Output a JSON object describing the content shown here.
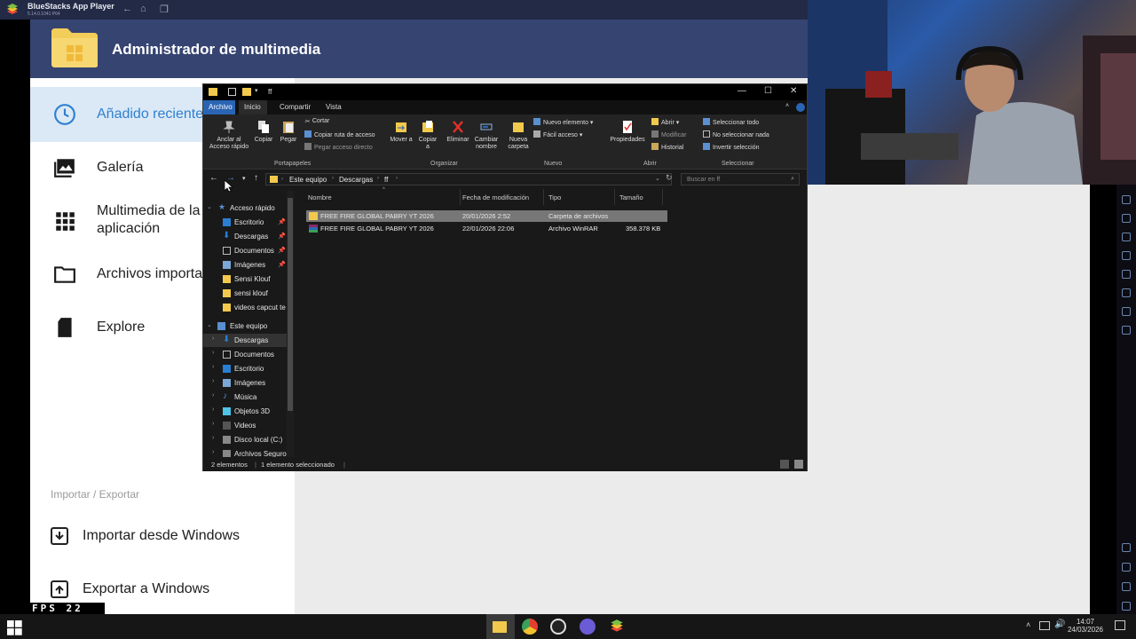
{
  "bluestacks": {
    "title": "BlueStacks App Player",
    "subtitle": "5.14.0.1041 P64"
  },
  "media_manager": {
    "title": "Administrador de multimedia",
    "nav": [
      {
        "label": "Añadido recientemente",
        "icon": "clock-icon",
        "active": true
      },
      {
        "label": "Galería",
        "icon": "gallery-icon",
        "active": false
      },
      {
        "label": "Multimedia de la aplicación",
        "icon": "grid-icon",
        "active": false
      },
      {
        "label": "Archivos importados",
        "icon": "folder-icon",
        "active": false
      },
      {
        "label": "Explore",
        "icon": "sd-card-icon",
        "active": false
      }
    ],
    "section_header": "Importar / Exportar",
    "import_label": "Importar desde Windows",
    "export_label": "Exportar a Windows"
  },
  "fps": {
    "label": "FPS",
    "value": "22"
  },
  "explorer": {
    "title": "ff",
    "menu": [
      "Archivo",
      "Inicio",
      "Compartir",
      "Vista"
    ],
    "ribbon": {
      "pin": "Anclar al Acceso rápido",
      "copy": "Copiar",
      "paste": "Pegar",
      "cut": "Cortar",
      "copy_path": "Copiar ruta de acceso",
      "paste_shortcut": "Pegar acceso directo",
      "move_to": "Mover a",
      "copy_to": "Copiar a",
      "delete": "Eliminar",
      "rename": "Cambiar nombre",
      "new_folder": "Nueva carpeta",
      "new_item": "Nuevo elemento",
      "easy_access": "Fácil acceso",
      "properties": "Propiedades",
      "open": "Abrir",
      "edit": "Modificar",
      "history": "Historial",
      "select_all": "Seleccionar todo",
      "select_none": "No seleccionar nada",
      "invert": "Invertir selección",
      "groups": [
        "Portapapeles",
        "Organizar",
        "Nuevo",
        "Abrir",
        "Seleccionar"
      ]
    },
    "breadcrumb": [
      "Este equipo",
      "Descargas",
      "ff"
    ],
    "search_placeholder": "Buscar en ff",
    "quick_access_label": "Acceso rápido",
    "quick_access": [
      {
        "label": "Escritorio",
        "pinned": true
      },
      {
        "label": "Descargas",
        "pinned": true
      },
      {
        "label": "Documentos",
        "pinned": true
      },
      {
        "label": "Imágenes",
        "pinned": true
      },
      {
        "label": "Sensi Klouf",
        "pinned": false
      },
      {
        "label": "sensi klouf",
        "pinned": false
      },
      {
        "label": "videos capcut te",
        "pinned": false
      }
    ],
    "this_pc_label": "Este equipo",
    "this_pc": [
      "Descargas",
      "Documentos",
      "Escritorio",
      "Imágenes",
      "Música",
      "Objetos 3D",
      "Videos",
      "Disco local (C:)",
      "Archivos Seguro"
    ],
    "columns": [
      "Nombre",
      "Fecha de modificación",
      "Tipo",
      "Tamaño"
    ],
    "files": [
      {
        "name": "FREE FIRE GLOBAL PABRY YT 2026",
        "date": "20/01/2026 2:52",
        "type": "Carpeta de archivos",
        "size": "",
        "selected": true
      },
      {
        "name": "FREE FIRE GLOBAL PABRY YT 2026",
        "date": "22/01/2026 22:06",
        "type": "Archivo WinRAR",
        "size": "358.378 KB",
        "selected": false
      }
    ],
    "status_count": "2 elementos",
    "status_selected": "1 elemento seleccionado"
  },
  "taskbar": {
    "time": "14:07",
    "date": "24/03/2026"
  }
}
